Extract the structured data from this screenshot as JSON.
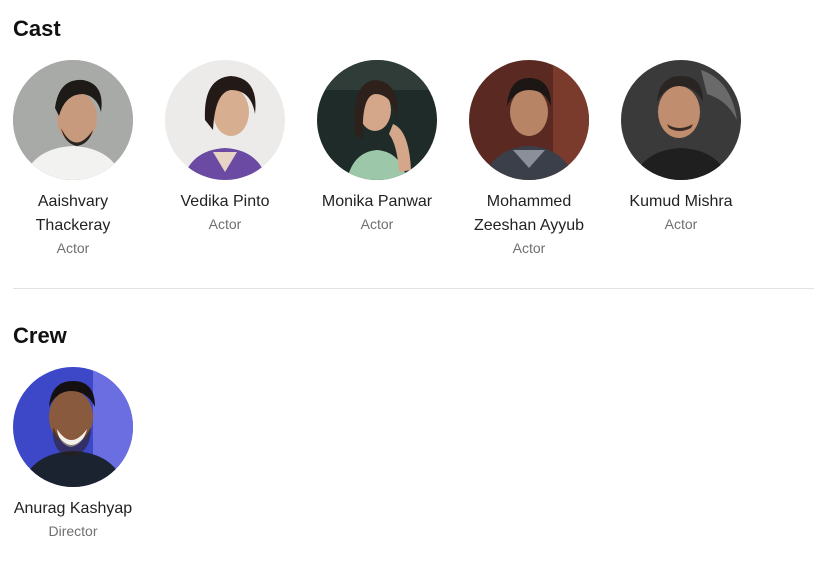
{
  "cast": {
    "title": "Cast",
    "people": [
      {
        "name": "Aaishvary Thackeray",
        "role": "Actor"
      },
      {
        "name": "Vedika Pinto",
        "role": "Actor"
      },
      {
        "name": "Monika Panwar",
        "role": "Actor"
      },
      {
        "name": "Mohammed Zeeshan Ayyub",
        "role": "Actor"
      },
      {
        "name": "Kumud Mishra",
        "role": "Actor"
      }
    ]
  },
  "crew": {
    "title": "Crew",
    "people": [
      {
        "name": "Anurag Kashyap",
        "role": "Director"
      }
    ]
  }
}
